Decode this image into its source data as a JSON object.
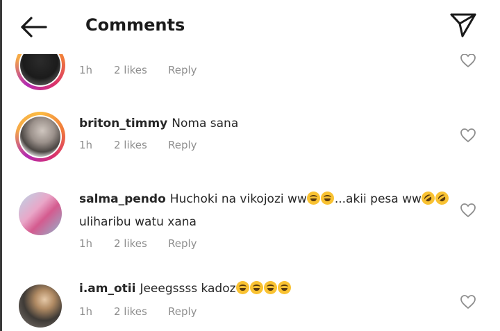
{
  "header": {
    "title": "Comments",
    "back_icon": "arrow-left-icon",
    "send_icon": "paper-plane-icon"
  },
  "comments": [
    {
      "username": "",
      "text": "",
      "time": "1h",
      "likes": "2 likes",
      "reply": "Reply"
    },
    {
      "username": "briton_timmy",
      "text": "Noma sana",
      "time": "1h",
      "likes": "2 likes",
      "reply": "Reply"
    },
    {
      "username": "salma_pendo",
      "text_part1": "Huchoki na vikojozi ww",
      "text_part2": "...akii pesa ww",
      "text_line2": "uliharibu watu xana",
      "time": "1h",
      "likes": "2 likes",
      "reply": "Reply"
    },
    {
      "username": "i.am_otii",
      "text": "Jeeegssss kadoz",
      "time": "1h",
      "likes": "2 likes",
      "reply": "Reply"
    }
  ],
  "colors": {
    "text": "#262626",
    "muted": "#8e8e8e",
    "ring_start": "#fbbc45",
    "ring_end": "#d9316d"
  }
}
